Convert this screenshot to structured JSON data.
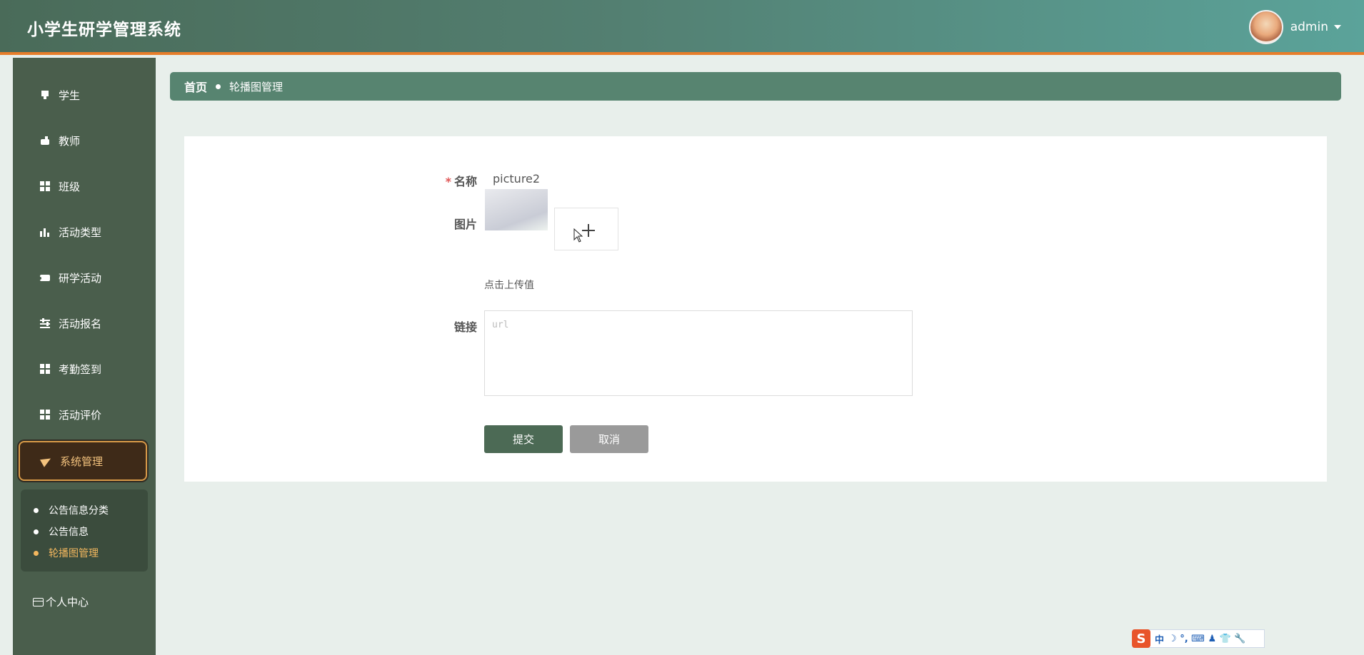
{
  "header": {
    "app_title": "小学生研学管理系统",
    "username": "admin"
  },
  "sidebar": {
    "items": [
      {
        "label": "学生",
        "icon": "book-icon"
      },
      {
        "label": "教师",
        "icon": "hand-icon"
      },
      {
        "label": "班级",
        "icon": "grid-icon"
      },
      {
        "label": "活动类型",
        "icon": "bar-chart-icon"
      },
      {
        "label": "研学活动",
        "icon": "ticket-icon"
      },
      {
        "label": "活动报名",
        "icon": "sliders-icon"
      },
      {
        "label": "考勤签到",
        "icon": "grid-icon"
      },
      {
        "label": "活动评价",
        "icon": "grid-icon"
      },
      {
        "label": "系统管理",
        "icon": "paper-plane-icon",
        "active": true
      }
    ],
    "submenu": [
      {
        "label": "公告信息分类"
      },
      {
        "label": "公告信息"
      },
      {
        "label": "轮播图管理",
        "active": true
      }
    ],
    "profile_label": "个人中心"
  },
  "breadcrumb": {
    "home": "首页",
    "current": "轮播图管理"
  },
  "form": {
    "name_label": "名称",
    "name_value": "picture2",
    "image_label": "图片",
    "upload_hint": "点击上传值",
    "link_label": "链接",
    "link_placeholder": "url",
    "submit_label": "提交",
    "cancel_label": "取消"
  },
  "ime": {
    "logo": "S",
    "mode": "中",
    "symbols": "☽ °, ⌨ ♟ 👕 🔧"
  },
  "colors": {
    "accent_orange": "#e77d2a",
    "sidebar_bg": "#4a5e4c",
    "breadcrumb_bg": "#578470",
    "submit_bg": "#4c6a55",
    "cancel_bg": "#9a9a9a",
    "active_text": "#f3c27d"
  }
}
